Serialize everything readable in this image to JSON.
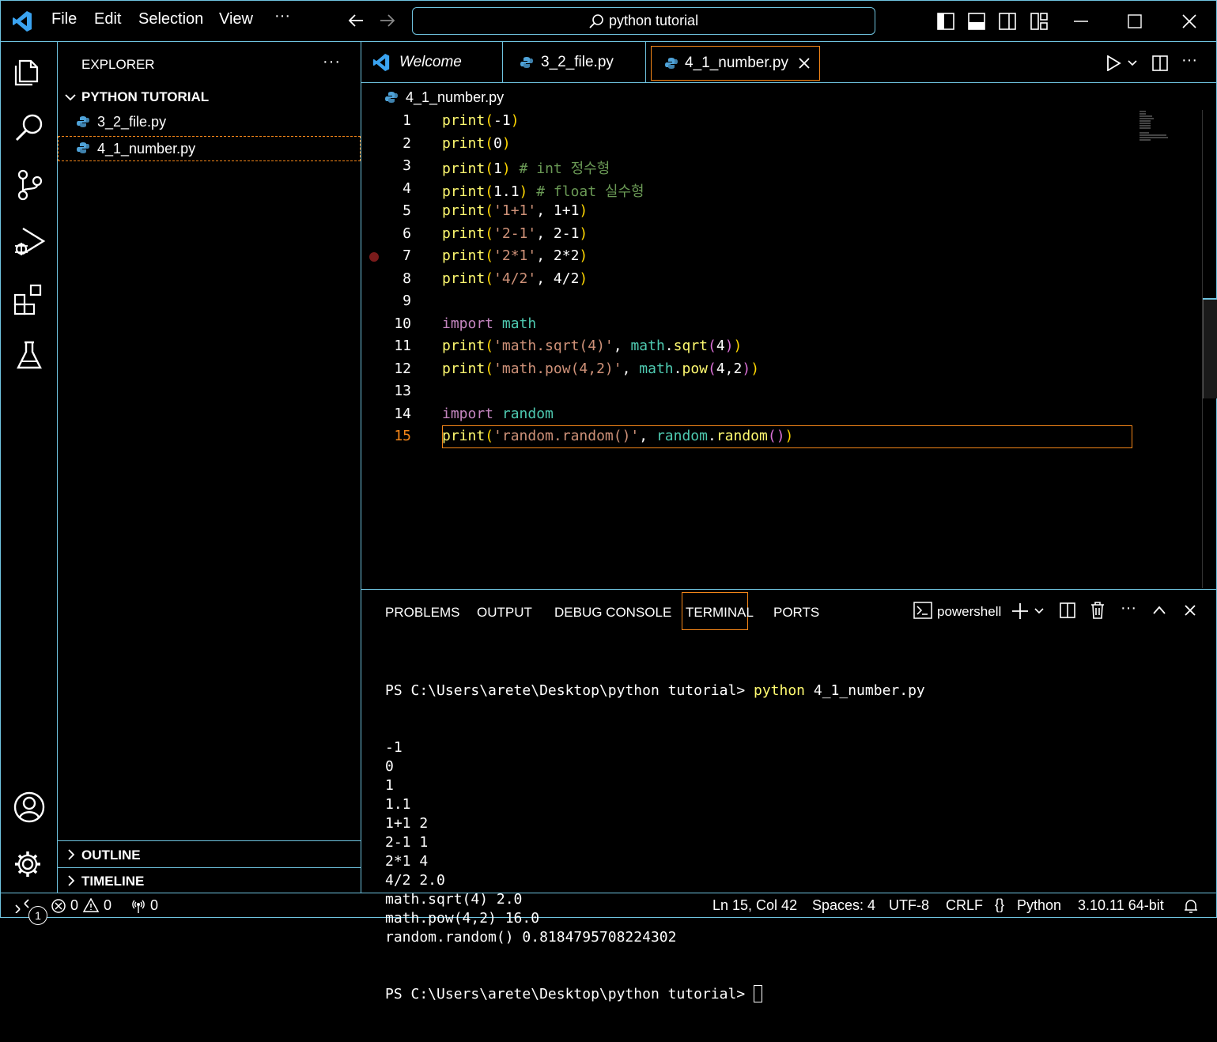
{
  "titlebar": {
    "menu": [
      "File",
      "Edit",
      "Selection",
      "View",
      "···"
    ],
    "search": "python tutorial"
  },
  "sidebar": {
    "title": "EXPLORER",
    "folder": "PYTHON TUTORIAL",
    "files": [
      "3_2_file.py",
      "4_1_number.py"
    ],
    "outline": "OUTLINE",
    "timeline": "TIMELINE"
  },
  "tabs": [
    {
      "label": "Welcome"
    },
    {
      "label": "3_2_file.py"
    },
    {
      "label": "4_1_number.py"
    }
  ],
  "breadcrumb": "4_1_number.py",
  "code": [
    {
      "n": "1",
      "tokens": [
        [
          "print",
          "fn"
        ],
        [
          "(",
          "b1"
        ],
        [
          "-1",
          "num"
        ],
        [
          ")",
          "b1"
        ]
      ]
    },
    {
      "n": "2",
      "tokens": [
        [
          "print",
          "fn"
        ],
        [
          "(",
          "b1"
        ],
        [
          "0",
          "num"
        ],
        [
          ")",
          "b1"
        ]
      ]
    },
    {
      "n": "3",
      "tokens": [
        [
          "print",
          "fn"
        ],
        [
          "(",
          "b1"
        ],
        [
          "1",
          "num"
        ],
        [
          ")",
          "b1"
        ],
        [
          " # int 정수형",
          "cm"
        ]
      ]
    },
    {
      "n": "4",
      "tokens": [
        [
          "print",
          "fn"
        ],
        [
          "(",
          "b1"
        ],
        [
          "1.1",
          "num"
        ],
        [
          ")",
          "b1"
        ],
        [
          " # float 실수형",
          "cm"
        ]
      ]
    },
    {
      "n": "5",
      "tokens": [
        [
          "print",
          "fn"
        ],
        [
          "(",
          "b1"
        ],
        [
          "'1+1'",
          "str"
        ],
        [
          ", ",
          "pl"
        ],
        [
          "1+1",
          "num"
        ],
        [
          ")",
          "b1"
        ]
      ]
    },
    {
      "n": "6",
      "tokens": [
        [
          "print",
          "fn"
        ],
        [
          "(",
          "b1"
        ],
        [
          "'2-1'",
          "str"
        ],
        [
          ", ",
          "pl"
        ],
        [
          "2-1",
          "num"
        ],
        [
          ")",
          "b1"
        ]
      ]
    },
    {
      "n": "7",
      "tokens": [
        [
          "print",
          "fn"
        ],
        [
          "(",
          "b1"
        ],
        [
          "'2*1'",
          "str"
        ],
        [
          ", ",
          "pl"
        ],
        [
          "2*2",
          "num"
        ],
        [
          ")",
          "b1"
        ]
      ]
    },
    {
      "n": "8",
      "tokens": [
        [
          "print",
          "fn"
        ],
        [
          "(",
          "b1"
        ],
        [
          "'4/2'",
          "str"
        ],
        [
          ", ",
          "pl"
        ],
        [
          "4/2",
          "num"
        ],
        [
          ")",
          "b1"
        ]
      ]
    },
    {
      "n": "9",
      "tokens": []
    },
    {
      "n": "10",
      "tokens": [
        [
          "import",
          "kw"
        ],
        [
          " ",
          "pl"
        ],
        [
          "math",
          "mod"
        ]
      ]
    },
    {
      "n": "11",
      "tokens": [
        [
          "print",
          "fn"
        ],
        [
          "(",
          "b1"
        ],
        [
          "'math.sqrt(4)'",
          "str"
        ],
        [
          ", ",
          "pl"
        ],
        [
          "math",
          "mod"
        ],
        [
          ".",
          "pl"
        ],
        [
          "sqrt",
          "fn"
        ],
        [
          "(",
          "b2"
        ],
        [
          "4",
          "num"
        ],
        [
          ")",
          "b2"
        ],
        [
          ")",
          "b1"
        ]
      ]
    },
    {
      "n": "12",
      "tokens": [
        [
          "print",
          "fn"
        ],
        [
          "(",
          "b1"
        ],
        [
          "'math.pow(4,2)'",
          "str"
        ],
        [
          ", ",
          "pl"
        ],
        [
          "math",
          "mod"
        ],
        [
          ".",
          "pl"
        ],
        [
          "pow",
          "fn"
        ],
        [
          "(",
          "b2"
        ],
        [
          "4,2",
          "num"
        ],
        [
          ")",
          "b2"
        ],
        [
          ")",
          "b1"
        ]
      ]
    },
    {
      "n": "13",
      "tokens": []
    },
    {
      "n": "14",
      "tokens": [
        [
          "import",
          "kw"
        ],
        [
          " ",
          "pl"
        ],
        [
          "random",
          "mod"
        ]
      ]
    },
    {
      "n": "15",
      "tokens": [
        [
          "print",
          "fn"
        ],
        [
          "(",
          "b1"
        ],
        [
          "'random.random()'",
          "str"
        ],
        [
          ", ",
          "pl"
        ],
        [
          "random",
          "mod"
        ],
        [
          ".",
          "pl"
        ],
        [
          "random",
          "fn"
        ],
        [
          "(",
          "b2"
        ],
        [
          ")",
          "b2"
        ],
        [
          ")",
          "b1"
        ]
      ]
    }
  ],
  "panel": {
    "tabs": [
      "PROBLEMS",
      "OUTPUT",
      "DEBUG CONSOLE",
      "TERMINAL",
      "PORTS"
    ],
    "shell": "powershell",
    "prompt": "PS C:\\Users\\arete\\Desktop\\python tutorial> ",
    "command": "python",
    "command_arg": " 4_1_number.py",
    "output": [
      "-1",
      "0",
      "1",
      "1.1",
      "1+1 2",
      "2-1 1",
      "2*1 4",
      "4/2 2.0",
      "math.sqrt(4) 2.0",
      "math.pow(4,2) 16.0",
      "random.random() 0.8184795708224302"
    ]
  },
  "status": {
    "errors": "0",
    "warnings": "0",
    "ports": "0",
    "position": "Ln 15, Col 42",
    "spaces": "Spaces: 4",
    "encoding": "UTF-8",
    "eol": "CRLF",
    "language": "Python",
    "interpreter": "3.10.11 64-bit",
    "settings_badge": "1"
  },
  "colors": {
    "fn": "#fffa70",
    "num": "#fff",
    "str": "#ce9178",
    "cm": "#6a9955",
    "kw": "#c586c0",
    "mod": "#4ec9b0",
    "b1": "#ffd700",
    "b2": "#da70d6",
    "pl": "#fff",
    "accent": "#f38518",
    "border": "#6fc3df"
  }
}
